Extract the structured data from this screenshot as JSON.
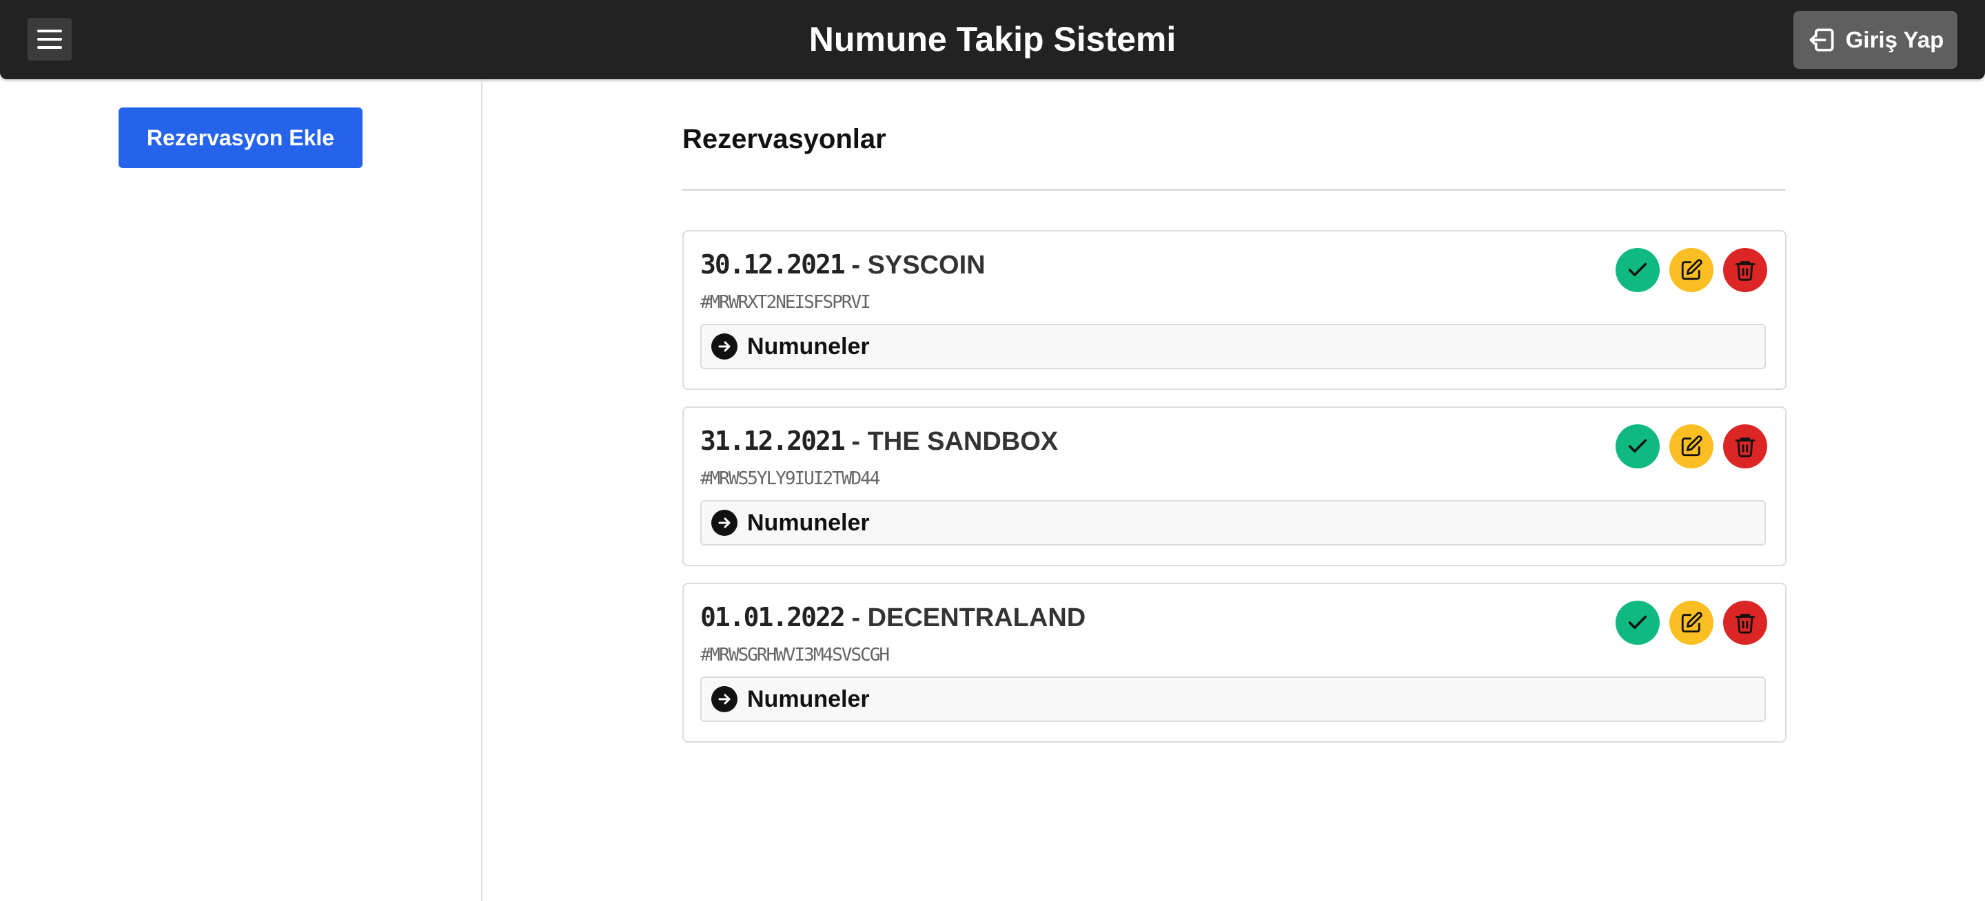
{
  "header": {
    "title": "Numune Takip Sistemi",
    "login_label": "Giriş Yap"
  },
  "sidebar": {
    "add_label": "Rezervasyon Ekle"
  },
  "main": {
    "section_title": "Rezervasyonlar",
    "reservations": [
      {
        "date": "30.12.2021",
        "name": "SYSCOIN",
        "code": "#MRWRXT2NEISFSPRVI",
        "samples_label": "Numuneler"
      },
      {
        "date": "31.12.2021",
        "name": "THE SANDBOX",
        "code": "#MRWS5YLY9IUI2TWD44",
        "samples_label": "Numuneler"
      },
      {
        "date": "01.01.2022",
        "name": "DECENTRALAND",
        "code": "#MRWSGRHWVI3M4SVSCGH",
        "samples_label": "Numuneler"
      }
    ],
    "separator": " - "
  },
  "colors": {
    "topbar": "#222222",
    "primary": "#2563eb",
    "approve": "#10b981",
    "edit": "#fbbf24",
    "delete": "#dc2626"
  },
  "icons": {
    "menu": "hamburger-icon",
    "login": "sign-in-icon",
    "approve": "check-icon",
    "edit": "edit-icon",
    "delete": "trash-icon",
    "samples": "arrow-right-circle-icon"
  }
}
